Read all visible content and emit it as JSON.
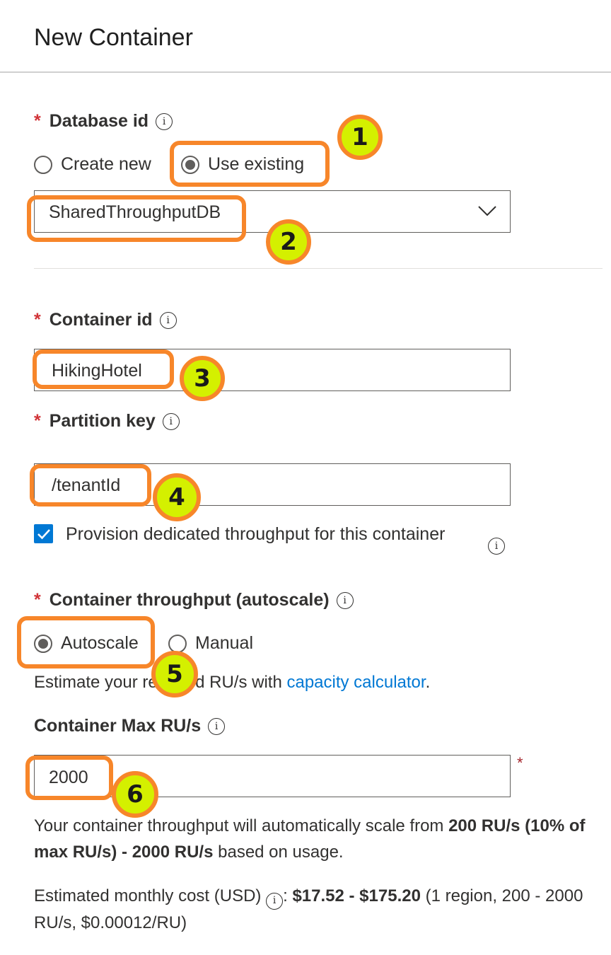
{
  "panel": {
    "title": "New Container"
  },
  "database": {
    "label": "Database id",
    "options": [
      "Create new",
      "Use existing"
    ],
    "selected": "Use existing",
    "value": "SharedThroughputDB"
  },
  "container": {
    "label": "Container id",
    "value": "HikingHotel"
  },
  "partition": {
    "label": "Partition key",
    "value": "/tenantId"
  },
  "provision": {
    "label": "Provision dedicated throughput for this container",
    "checked": true
  },
  "throughput": {
    "label": "Container throughput (autoscale)",
    "options": [
      "Autoscale",
      "Manual"
    ],
    "selected": "Autoscale",
    "estimate_prefix": "Estimate your required RU/s with ",
    "estimate_link": "capacity calculator",
    "estimate_suffix": "."
  },
  "max_ru": {
    "label": "Container Max RU/s",
    "value": "2000",
    "required_mark": "*",
    "scale_prefix": "Your container throughput will automatically scale from ",
    "scale_bold": "200 RU/s (10% of max RU/s) - 2000 RU/s",
    "scale_suffix": " based on usage."
  },
  "cost": {
    "prefix": "Estimated monthly cost (USD) ",
    "colon": ": ",
    "bold": "$17.52 - $175.20",
    "detail": " (1 region, 200 - 2000 RU/s, $0.00012/RU)"
  },
  "required_star": "*",
  "info_glyph": "i",
  "badges": [
    "1",
    "2",
    "3",
    "4",
    "5",
    "6"
  ],
  "colors": {
    "accent": "#0078d4",
    "highlight": "#f7862a",
    "badge_fill": "#d4f000",
    "required": "#d13438"
  }
}
